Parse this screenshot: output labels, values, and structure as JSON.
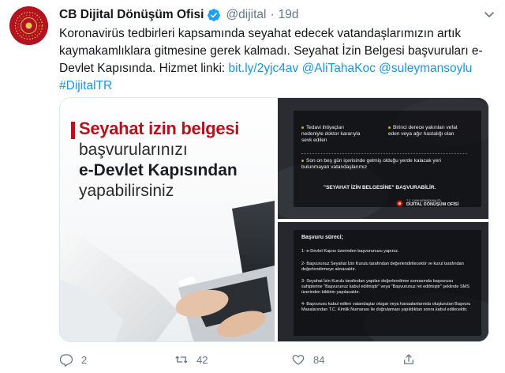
{
  "tweet": {
    "display_name": "CB Dijital Dönüşüm Ofisi",
    "handle": "@dijital",
    "separator": "·",
    "time": "19d",
    "text_plain": "Koronavirüs tedbirleri kapsamında seyahat edecek vatandaşlarımızın artık kaymakamlıklara gitmesine gerek kalmadı. Seyahat İzin Belgesi başvuruları e-Devlet Kapısında. Hizmet linki: ",
    "link": "bit.ly/2yjc4av",
    "mention1": "@AliTahaKoc",
    "mention2": "@suleymansoylu",
    "hashtag": "#DijitalTR",
    "avatar_icon": "presidential-seal-icon",
    "verified_icon": "verified-badge-icon",
    "accent_color": "#1b95e0",
    "brand_color": "#b3121f"
  },
  "media": {
    "image1": {
      "line1": "Seyahat izin belgesi",
      "line2": "başvurularınızı",
      "line3": "e-Devlet Kapısından",
      "line4": "yapabilirsiniz"
    },
    "image2": {
      "col1_item1": "Tedavi ihtiyaçları nedeniyle doktor kararıyla sevk edilen",
      "col2_item1": "Birinci derece yakınları vefat eden veya ağır hastalığı olan",
      "item3": "Son on beş gün içerisinde gelmiş olduğu yerde kalacak yeri bulunmayan vatandaşlarımız",
      "cta": "\"SEYAHAT İZİN BELGESİNE\" BAŞVURABİLİR.",
      "logo_small": "T.C. CUMHURBAŞKANLIĞI",
      "logo_main": "DİJİTAL DÖNÜŞÜM OFİSİ"
    },
    "image3": {
      "title": "Başvuru süreci;",
      "step1": "1- e-Devlet Kapısı üzerinden başvurunuzu yapınız.",
      "step2": "2- Başvurunuz Seyahat İzin Kurulu tarafından değerlendirilecektir ve kurul tarafından değerlendirmeye alınacaktır.",
      "step3": "3- Seyahat İzin Kurulu tarafından yapılan değerlendirme sonrasında başvurusu sahiplerine \"Başvurunuz kabul edilmiştir\" veya \"Başvurunuz ret edilmiştir\" şeklinde SMS üzerinden bildirim yapılacaktır.",
      "step4": "4- Başvurusu kabul edilen vatandaşlar otogar veya havaalanlarında oluşturulan Başvuru Masalarından T.C. Kimlik Numarası ile doğrulaması yapıldıktan sonra kabul edilecektir."
    }
  },
  "actions": {
    "reply_count": "2",
    "retweet_count": "42",
    "like_count": "84",
    "reply_icon": "reply-icon",
    "retweet_icon": "retweet-icon",
    "like_icon": "heart-icon",
    "share_icon": "share-icon"
  }
}
